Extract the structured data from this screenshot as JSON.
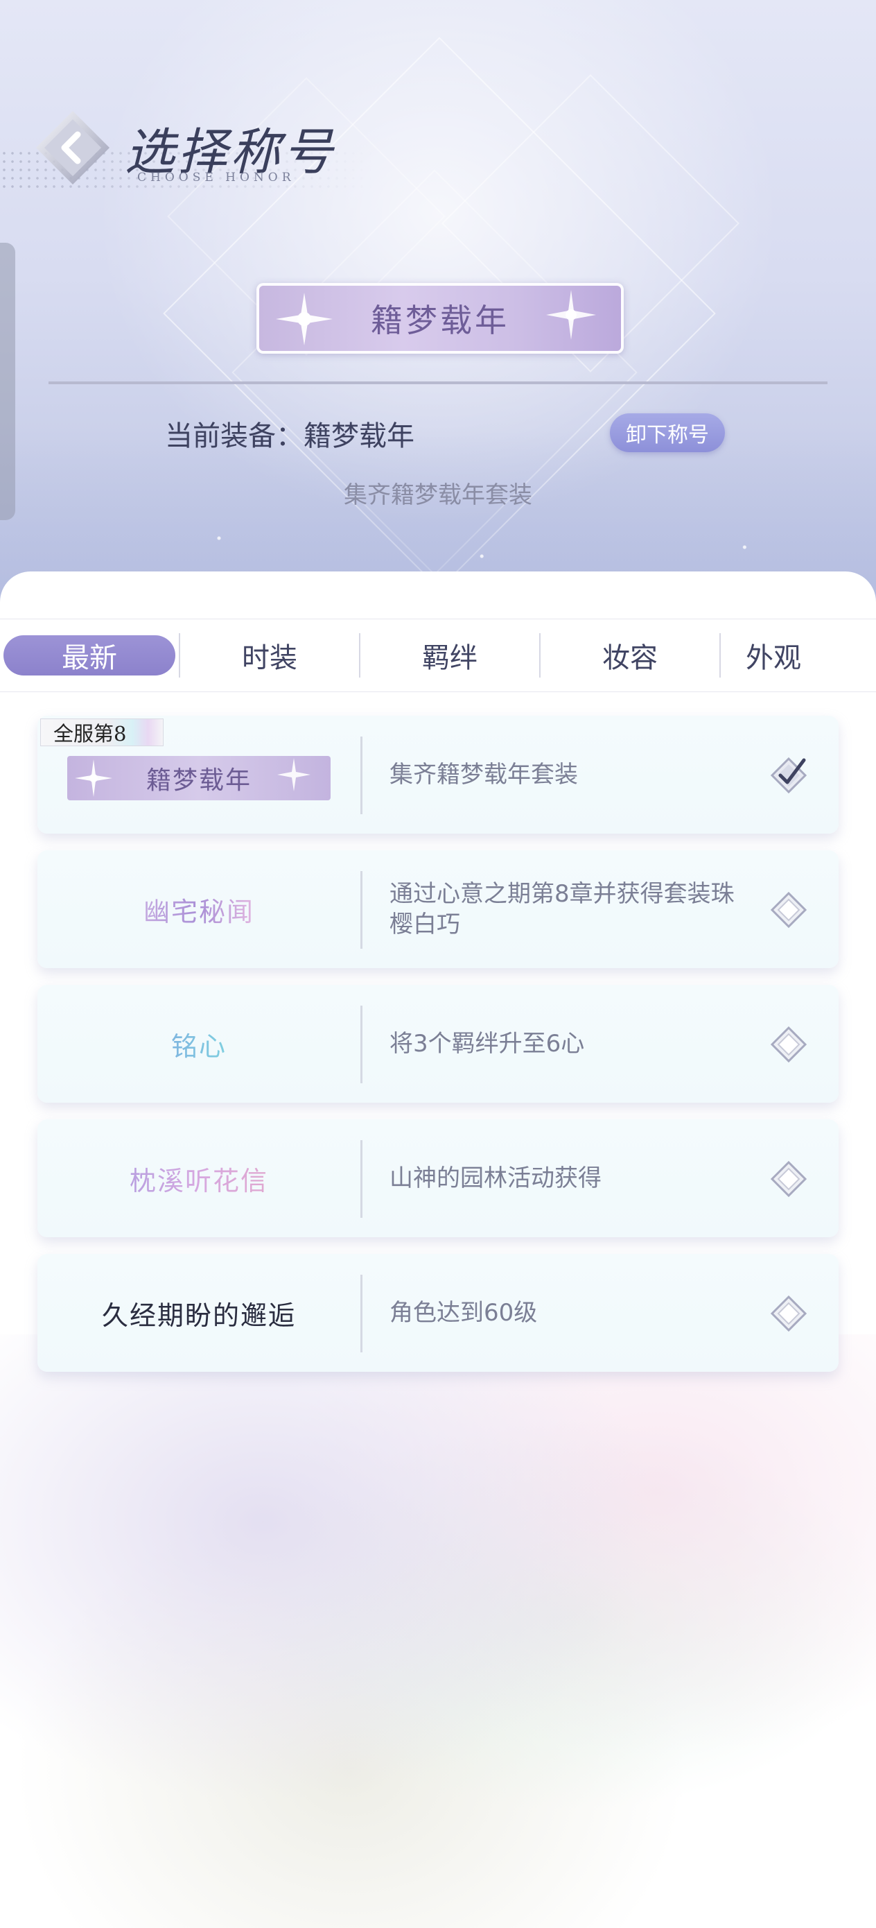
{
  "header": {
    "title": "选择称号",
    "subtitle": "CHOOSE HONOR"
  },
  "current": {
    "plate_text": "籍梦载年",
    "equipped_label": "当前装备：籍梦载年",
    "unequip_label": "卸下称号",
    "description": "集齐籍梦载年套装"
  },
  "tabs": [
    {
      "label": "最新",
      "active": true
    },
    {
      "label": "时装",
      "active": false
    },
    {
      "label": "羁绊",
      "active": false
    },
    {
      "label": "妆容",
      "active": false
    },
    {
      "label": "外观",
      "active": false
    }
  ],
  "honors": [
    {
      "name": "籍梦载年",
      "rank_badge": "全服第8",
      "desc": "集齐籍梦载年套装",
      "selected": true
    },
    {
      "name": "幽宅秘闻",
      "desc": "通过心意之期第8章并获得套装珠樱白巧",
      "selected": false
    },
    {
      "name": "铭心",
      "desc": "将3个羁绊升至6心",
      "selected": false
    },
    {
      "name": "枕溪听花信",
      "desc": "山神的园林活动获得",
      "selected": false
    },
    {
      "name": "久经期盼的邂逅",
      "desc": "角色达到60级",
      "selected": false
    }
  ],
  "colors": {
    "accent": "#8c82cc",
    "unequip_button": "#8d90d9",
    "text_dark": "#3e4260",
    "text_muted": "#8a8da5"
  }
}
